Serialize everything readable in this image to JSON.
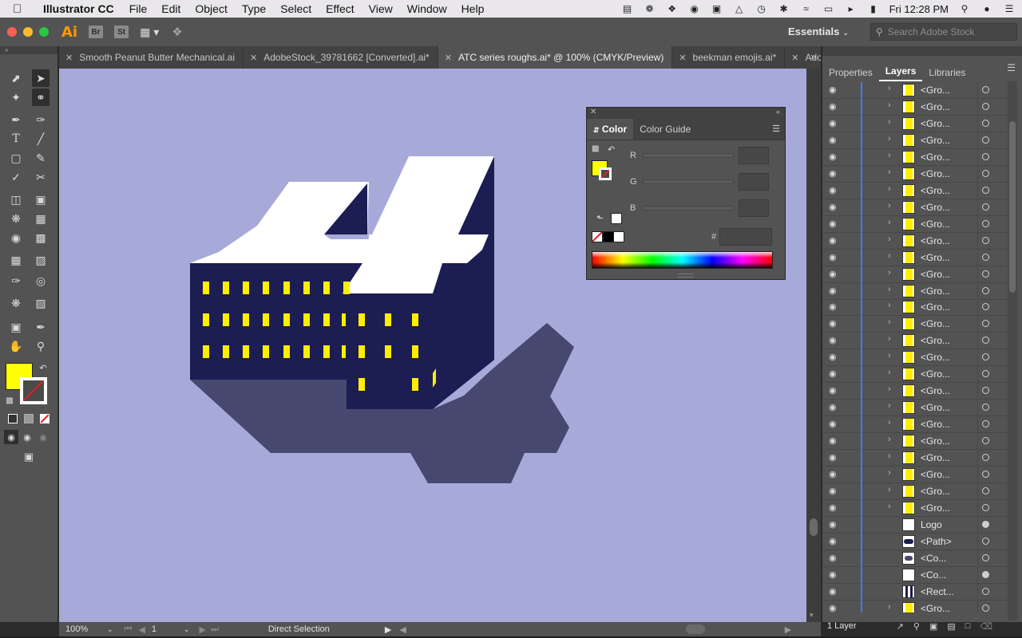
{
  "menubar": {
    "app_name": "Illustrator CC",
    "items": [
      "File",
      "Edit",
      "Object",
      "Type",
      "Select",
      "Effect",
      "View",
      "Window",
      "Help"
    ],
    "clock": "Fri 12:28 PM"
  },
  "appbar": {
    "logo": "Ai",
    "bridge": "Br",
    "stock": "St",
    "workspace": "Essentials",
    "search_placeholder": "Search Adobe Stock"
  },
  "tabs": [
    {
      "label": "Smooth Peanut Butter Mechanical.ai",
      "active": false
    },
    {
      "label": "AdobeStock_39781662 [Converted].ai*",
      "active": false
    },
    {
      "label": "ATC series roughs.ai* @ 100% (CMYK/Preview)",
      "active": true
    },
    {
      "label": "beekman emojis.ai*",
      "active": false
    },
    {
      "label": "Adobe",
      "active": false
    }
  ],
  "status": {
    "zoom": "100%",
    "artboard": "1",
    "tool": "Direct Selection"
  },
  "panel_tabs": [
    "Properties",
    "Layers",
    "Libraries"
  ],
  "layers": {
    "group_label": "<Gro...",
    "group_count": 26,
    "bottom_rows": [
      {
        "name": "Logo",
        "chevron": false,
        "target_filled": true
      },
      {
        "name": "<Path>",
        "chevron": false,
        "target_filled": false
      },
      {
        "name": "<Co...",
        "chevron": false,
        "target_filled": false
      },
      {
        "name": "<Co...",
        "chevron": false,
        "target_filled": true
      },
      {
        "name": "<Rect...",
        "chevron": false,
        "target_filled": false
      },
      {
        "name": "<Gro...",
        "chevron": true,
        "target_filled": false
      }
    ],
    "footer": "1 Layer"
  },
  "color_panel": {
    "tabs": [
      "Color",
      "Color Guide"
    ],
    "channels": [
      "R",
      "G",
      "B"
    ],
    "hex_label": "#"
  },
  "colors": {
    "fill": "#ffff00",
    "canvas": "#a7aad8",
    "building": "#1c1d52",
    "shadow": "#464870",
    "window": "#ffee00",
    "selection": "#3d7dff"
  }
}
